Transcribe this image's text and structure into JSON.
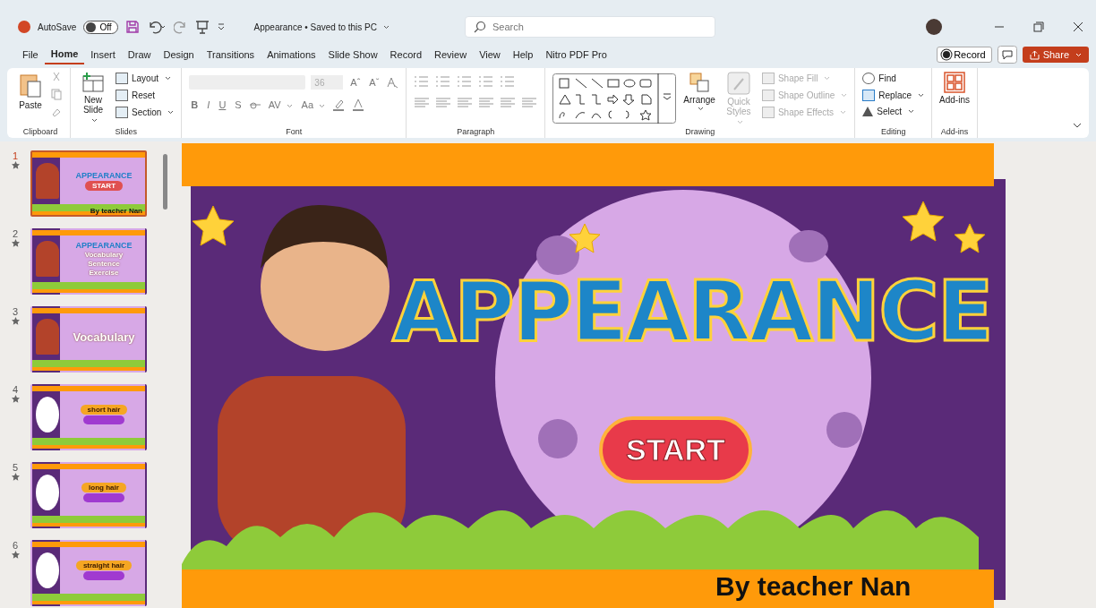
{
  "title_bar": {
    "autosave_label": "AutoSave",
    "autosave_toggle": {
      "label": "Off",
      "on": false
    },
    "document_title": "Appearance • Saved to this PC",
    "search": {
      "placeholder": "Search"
    }
  },
  "menu_tabs": [
    {
      "label": "File",
      "selected": false
    },
    {
      "label": "Home",
      "selected": true
    },
    {
      "label": "Insert",
      "selected": false
    },
    {
      "label": "Draw",
      "selected": false
    },
    {
      "label": "Design",
      "selected": false
    },
    {
      "label": "Transitions",
      "selected": false
    },
    {
      "label": "Animations",
      "selected": false
    },
    {
      "label": "Slide Show",
      "selected": false
    },
    {
      "label": "Record",
      "selected": false
    },
    {
      "label": "Review",
      "selected": false
    },
    {
      "label": "View",
      "selected": false
    },
    {
      "label": "Help",
      "selected": false
    },
    {
      "label": "Nitro PDF Pro",
      "selected": false
    }
  ],
  "header_buttons": {
    "record": "Record",
    "share": "Share"
  },
  "ribbon": {
    "clipboard": {
      "label": "Clipboard",
      "paste": "Paste"
    },
    "slides": {
      "label": "Slides",
      "new_slide": "New Slide",
      "items": [
        "Layout",
        "Reset",
        "Section"
      ]
    },
    "font": {
      "label": "Font",
      "font_size": "36",
      "size_buttons": [
        "Aˆ",
        "Aˇ"
      ],
      "format_buttons": [
        "B",
        "I",
        "U",
        "S"
      ],
      "spacing": "AV",
      "case": "Aa"
    },
    "paragraph": {
      "label": "Paragraph"
    },
    "drawing": {
      "label": "Drawing",
      "arrange": "Arrange",
      "quick_styles": "Quick Styles",
      "shape_items": [
        "Shape Fill",
        "Shape Outline",
        "Shape Effects"
      ]
    },
    "editing": {
      "label": "Editing",
      "items": [
        "Find",
        "Replace",
        "Select"
      ]
    },
    "addins": {
      "label": "Add-ins",
      "button": "Add-ins"
    }
  },
  "thumbnails": [
    {
      "number": "1",
      "selected": true,
      "kind": "title",
      "texts": [
        "APPEARANCE",
        "START",
        "By teacher Nan"
      ]
    },
    {
      "number": "2",
      "selected": false,
      "kind": "menu",
      "texts": [
        "APPEARANCE",
        "Vocabulary",
        "Sentence",
        "Exercise"
      ]
    },
    {
      "number": "3",
      "selected": false,
      "kind": "heading",
      "texts": [
        "Vocabulary"
      ]
    },
    {
      "number": "4",
      "selected": false,
      "kind": "word",
      "texts": [
        "short hair"
      ]
    },
    {
      "number": "5",
      "selected": false,
      "kind": "word",
      "texts": [
        "long hair"
      ]
    },
    {
      "number": "6",
      "selected": false,
      "kind": "word",
      "texts": [
        "straight hair"
      ]
    }
  ],
  "slide": {
    "title": "APPEARANCE",
    "start_button": "START",
    "author": "By teacher Nan"
  }
}
